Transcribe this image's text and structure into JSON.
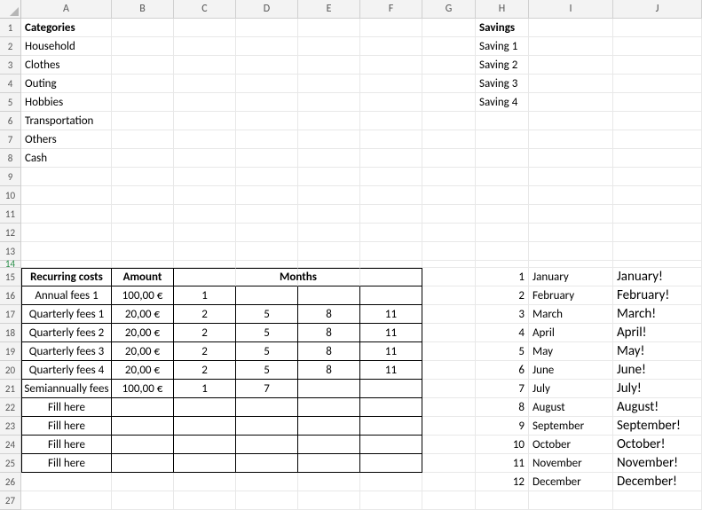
{
  "columns": [
    "A",
    "B",
    "C",
    "D",
    "E",
    "F",
    "G",
    "H",
    "I",
    "J"
  ],
  "rowCount": 27,
  "categories": {
    "header": "Categories",
    "items": [
      "Household",
      "Clothes",
      "Outing",
      "Hobbies",
      "Transportation",
      "Others",
      "Cash"
    ]
  },
  "savings": {
    "header": "Savings",
    "items": [
      "Saving 1",
      "Saving 2",
      "Saving 3",
      "Saving 4"
    ]
  },
  "recurring": {
    "headers": {
      "name": "Recurring costs",
      "amount": "Amount",
      "months": "Months"
    },
    "rows": [
      {
        "name": "Annual fees 1",
        "amount": "100,00 €",
        "months": [
          "1",
          "",
          "",
          ""
        ]
      },
      {
        "name": "Quarterly fees 1",
        "amount": "20,00 €",
        "months": [
          "2",
          "5",
          "8",
          "11"
        ]
      },
      {
        "name": "Quarterly fees 2",
        "amount": "20,00 €",
        "months": [
          "2",
          "5",
          "8",
          "11"
        ]
      },
      {
        "name": "Quarterly fees 3",
        "amount": "20,00 €",
        "months": [
          "2",
          "5",
          "8",
          "11"
        ]
      },
      {
        "name": "Quarterly fees 4",
        "amount": "20,00 €",
        "months": [
          "2",
          "5",
          "8",
          "11"
        ]
      },
      {
        "name": "Semiannually fees",
        "amount": "100,00 €",
        "months": [
          "1",
          "7",
          "",
          ""
        ]
      },
      {
        "name": "Fill here",
        "amount": "",
        "months": [
          "",
          "",
          "",
          ""
        ]
      },
      {
        "name": "Fill here",
        "amount": "",
        "months": [
          "",
          "",
          "",
          ""
        ]
      },
      {
        "name": "Fill here",
        "amount": "",
        "months": [
          "",
          "",
          "",
          ""
        ]
      },
      {
        "name": "Fill here",
        "amount": "",
        "months": [
          "",
          "",
          "",
          ""
        ]
      }
    ]
  },
  "monthIndex": {
    "numbers": [
      "1",
      "2",
      "3",
      "4",
      "5",
      "6",
      "7",
      "8",
      "9",
      "10",
      "11",
      "12"
    ],
    "names": [
      "January",
      "February",
      "March",
      "April",
      "May",
      "June",
      "July",
      "August",
      "September",
      "October",
      "November",
      "December"
    ],
    "sheets": [
      "January!",
      "February!",
      "March!",
      "April!",
      "May!",
      "June!",
      "July!",
      "August!",
      "September!",
      "October!",
      "November!",
      "December!"
    ]
  }
}
